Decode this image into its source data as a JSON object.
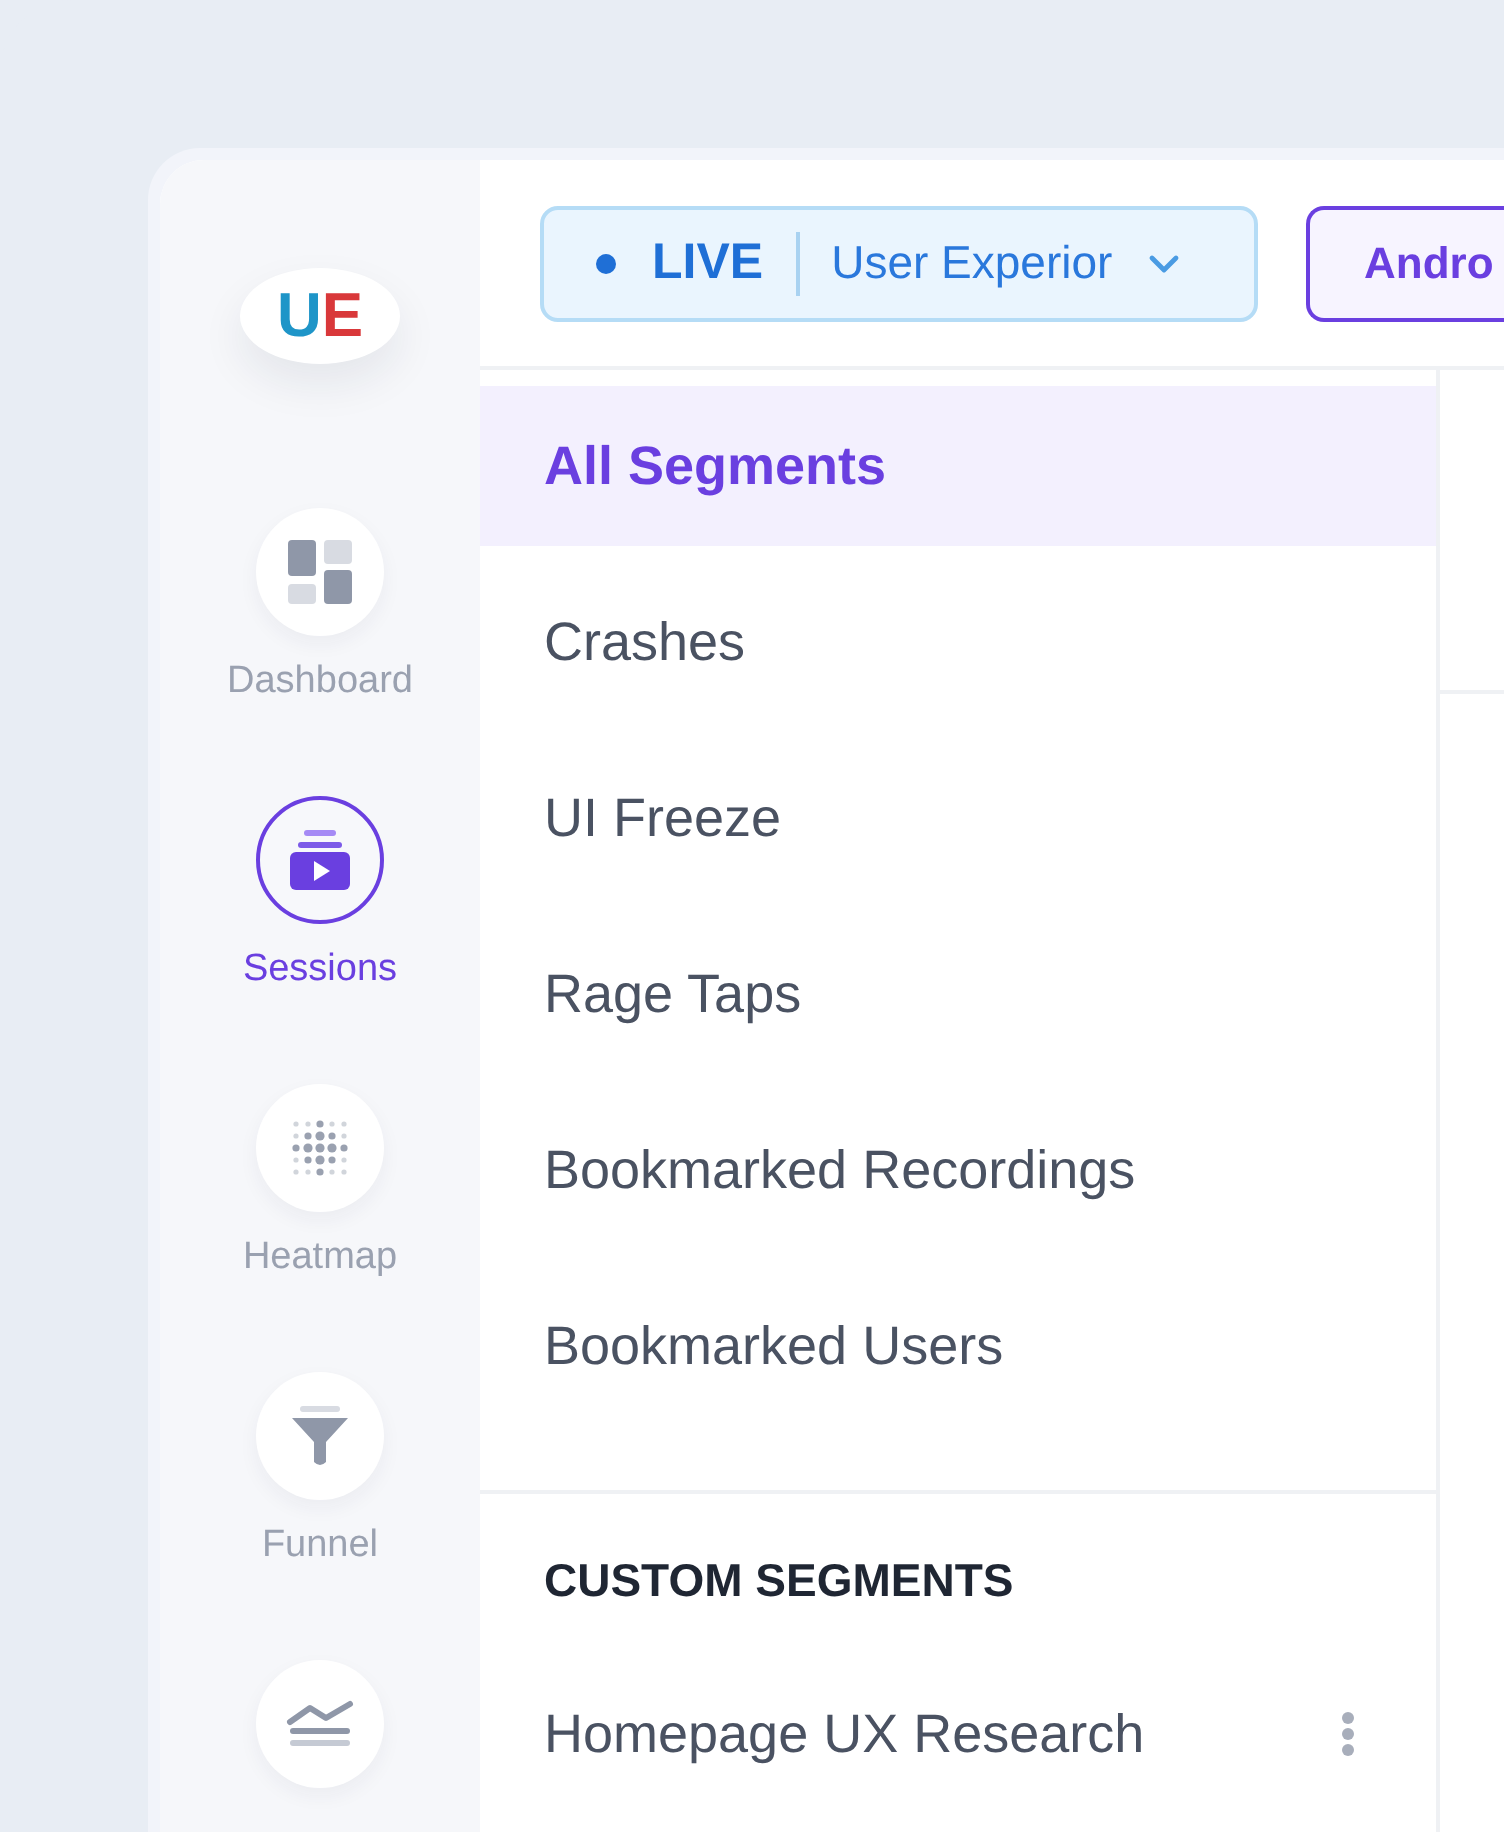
{
  "logo": {
    "first": "U",
    "second": "E"
  },
  "nav": [
    {
      "label": "Dashboard",
      "kind": "dashboard",
      "selected": false
    },
    {
      "label": "Sessions",
      "kind": "sessions",
      "selected": true
    },
    {
      "label": "Heatmap",
      "kind": "heatmap",
      "selected": false
    },
    {
      "label": "Funnel",
      "kind": "funnel",
      "selected": false
    },
    {
      "kind": "trend",
      "selected": false
    }
  ],
  "topbar": {
    "live_label": "LIVE",
    "app_name": "User Experior",
    "platform": "Andro"
  },
  "segments": [
    {
      "label": "All Segments",
      "selected": true
    },
    {
      "label": "Crashes",
      "selected": false
    },
    {
      "label": "UI Freeze",
      "selected": false
    },
    {
      "label": "Rage Taps",
      "selected": false
    },
    {
      "label": "Bookmarked Recordings",
      "selected": false
    },
    {
      "label": "Bookmarked Users",
      "selected": false
    }
  ],
  "custom_segments": {
    "heading": "CUSTOM SEGMENTS",
    "items": [
      {
        "label": "Homepage UX Research"
      }
    ]
  }
}
